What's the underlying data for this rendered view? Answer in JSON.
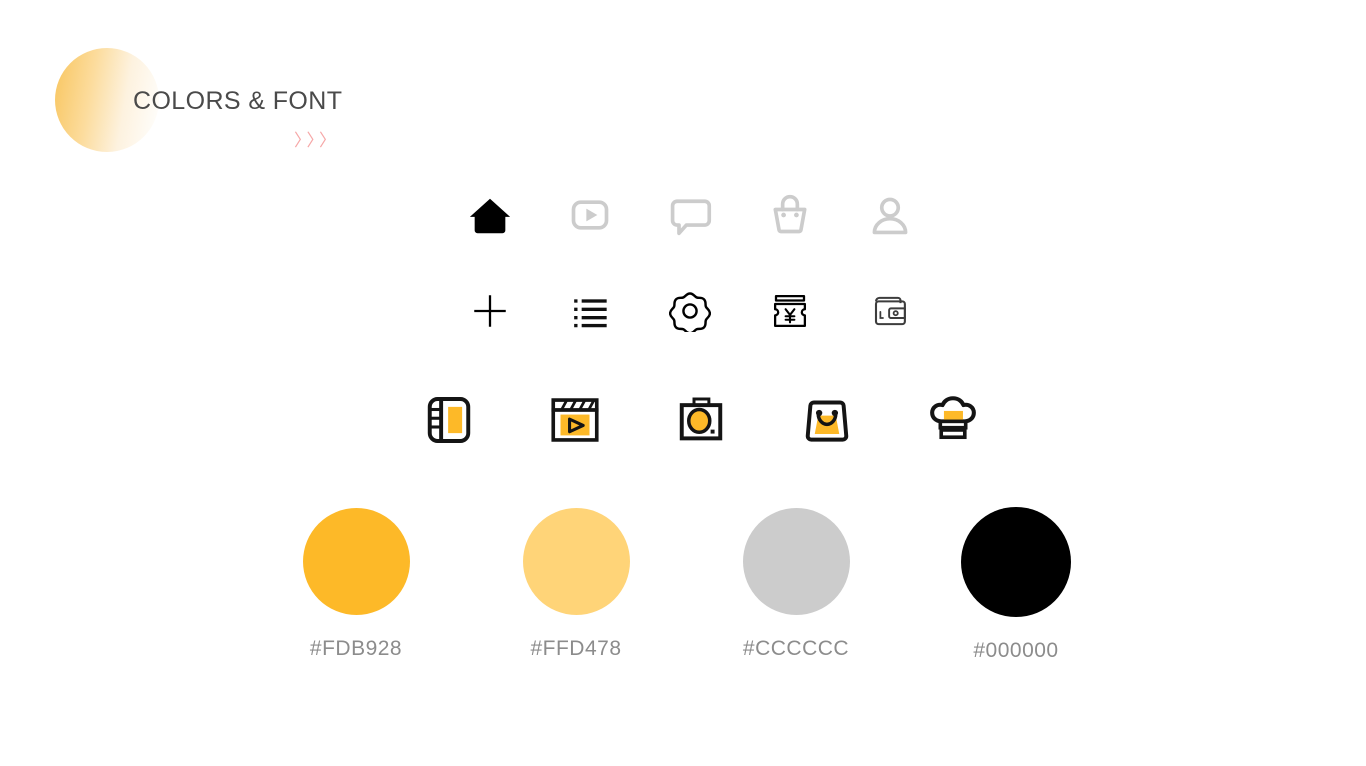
{
  "header": {
    "title": "COLORS & FONT",
    "chevrons": "〉〉〉",
    "orb_gradient_from": "#F8C55E",
    "orb_gradient_to": "#FFFFFF",
    "chevron_color": "#F6A7A7",
    "title_color": "#4A4A4A"
  },
  "icon_rows": [
    {
      "name": "navigation-icons",
      "icons": [
        {
          "name": "home-icon",
          "label": "Home",
          "style": "filled",
          "color": "#000000"
        },
        {
          "name": "video-play-icon",
          "label": "Video",
          "style": "outline",
          "color": "#CCCCCC"
        },
        {
          "name": "chat-bubble-icon",
          "label": "Chat",
          "style": "outline",
          "color": "#CCCCCC"
        },
        {
          "name": "shopping-bag-icon",
          "label": "Shop",
          "style": "outline",
          "color": "#CCCCCC"
        },
        {
          "name": "person-icon",
          "label": "Profile",
          "style": "outline",
          "color": "#CCCCCC"
        }
      ]
    },
    {
      "name": "tool-icons",
      "icons": [
        {
          "name": "plus-icon",
          "label": "Add",
          "style": "outline",
          "color": "#000000"
        },
        {
          "name": "list-icon",
          "label": "List",
          "style": "filled",
          "color": "#000000"
        },
        {
          "name": "gear-icon",
          "label": "Settings",
          "style": "outline",
          "color": "#000000"
        },
        {
          "name": "coupon-yen-icon",
          "label": "Coupon",
          "style": "outline",
          "color": "#000000"
        },
        {
          "name": "wallet-icon",
          "label": "Wallet",
          "style": "outline",
          "color": "#444444"
        }
      ]
    },
    {
      "name": "illustrated-icons",
      "icons": [
        {
          "name": "notebook-icon",
          "label": "Notebook",
          "style": "duotone",
          "color": "#FDB928"
        },
        {
          "name": "film-clapper-icon",
          "label": "Video",
          "style": "duotone",
          "color": "#FDB928"
        },
        {
          "name": "camera-icon",
          "label": "Camera",
          "style": "duotone",
          "color": "#FDB928"
        },
        {
          "name": "shopping-bag-smile-icon",
          "label": "Shopping",
          "style": "duotone",
          "color": "#FDB928"
        },
        {
          "name": "chef-hat-icon",
          "label": "Cooking",
          "style": "duotone",
          "color": "#FDB928"
        }
      ]
    }
  ],
  "swatches": [
    {
      "name": "swatch-primary",
      "hex": "#FDB928",
      "label": "#FDB928",
      "size": 107
    },
    {
      "name": "swatch-secondary",
      "hex": "#FFD478",
      "label": "#FFD478",
      "size": 107
    },
    {
      "name": "swatch-gray",
      "hex": "#CCCCCC",
      "label": "#CCCCCC",
      "size": 107
    },
    {
      "name": "swatch-black",
      "hex": "#000000",
      "label": "#000000",
      "size": 110
    }
  ],
  "label_color": "#8C8C8C"
}
